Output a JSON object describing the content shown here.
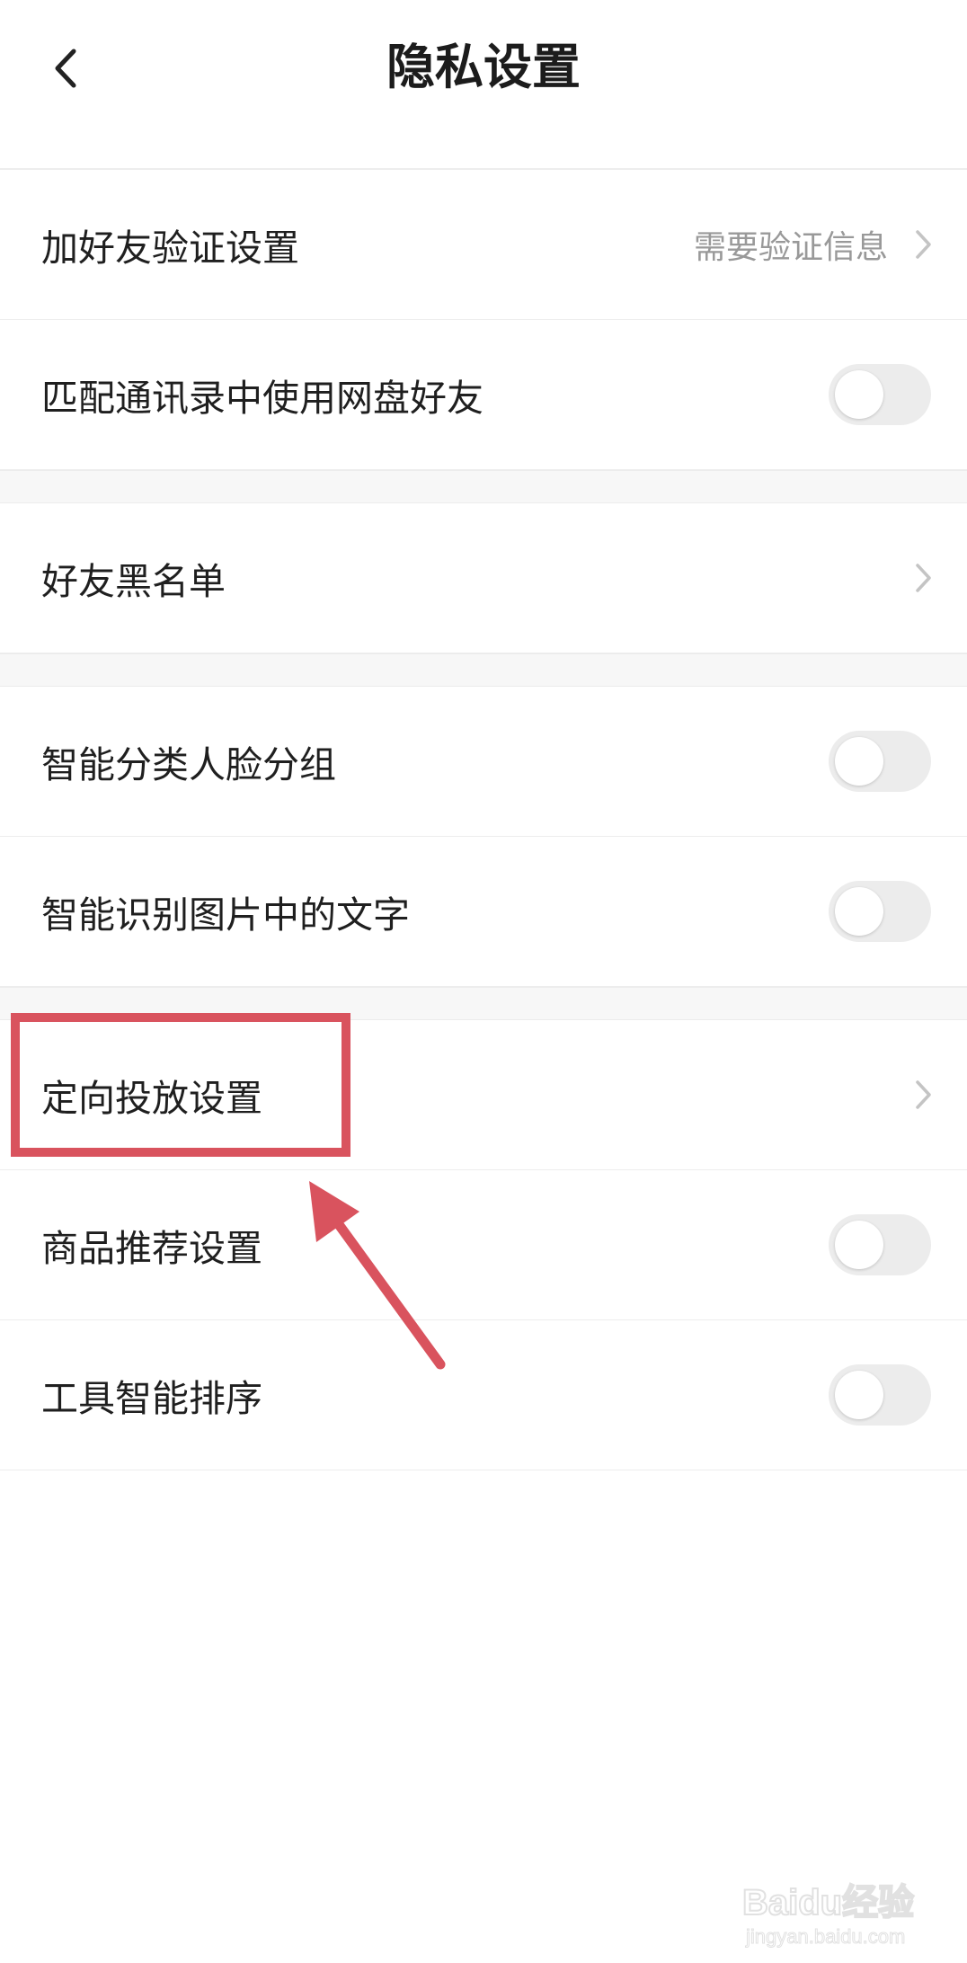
{
  "header": {
    "title": "隐私设置",
    "back_icon": "chevron-left-icon"
  },
  "colors": {
    "highlight": "#d9535e",
    "toggle_off": "#ececec",
    "secondary_text": "#999999"
  },
  "settings": {
    "friend_verify": {
      "label": "加好友验证设置",
      "value": "需要验证信息"
    },
    "contacts_match": {
      "label": "匹配通讯录中使用网盘好友",
      "enabled": false
    },
    "blacklist": {
      "label": "好友黑名单"
    },
    "face_group": {
      "label": "智能分类人脸分组",
      "enabled": false
    },
    "ocr_text": {
      "label": "智能识别图片中的文字",
      "enabled": false
    },
    "targeted_ads": {
      "label": "定向投放设置"
    },
    "product_recommend": {
      "label": "商品推荐设置",
      "enabled": false
    },
    "tool_sort": {
      "label": "工具智能排序",
      "enabled": false
    }
  },
  "watermark": {
    "brand": "Baidu经验",
    "sub": "jingyan.baidu.com"
  }
}
